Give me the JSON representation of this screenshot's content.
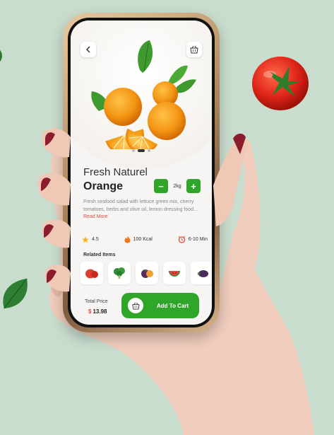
{
  "product": {
    "subtitle": "Fresh Naturel",
    "name": "Orange",
    "quantity": "2kg",
    "minus_label": "−",
    "plus_label": "+",
    "description": "Fresh seafood  salad with lettuce green mix, cherry tomatoes, herbs and olive oil, lemon dressing  food...",
    "read_more": "Read More",
    "stats": [
      {
        "icon": "star-icon",
        "value": "4.5"
      },
      {
        "icon": "flame-icon",
        "value": "100 Kcal"
      },
      {
        "icon": "alarm-clock-icon",
        "value": "6-10 Min"
      }
    ]
  },
  "carousel": {
    "count": 3,
    "active": 1
  },
  "related": {
    "title": "Related Items",
    "items": [
      {
        "icon": "tomato-icon"
      },
      {
        "icon": "broccoli-icon"
      },
      {
        "icon": "eggplant-icon"
      },
      {
        "icon": "watermelon-icon"
      },
      {
        "icon": "vegetable-icon"
      }
    ]
  },
  "checkout": {
    "total_label": "Total Price",
    "currency": "$",
    "total_value": "13.98",
    "add_to_cart_label": "Add To Cart"
  },
  "colors": {
    "background": "#c9ddcf",
    "accent_green": "#2fa52a",
    "accent_red": "#e34b3d"
  }
}
